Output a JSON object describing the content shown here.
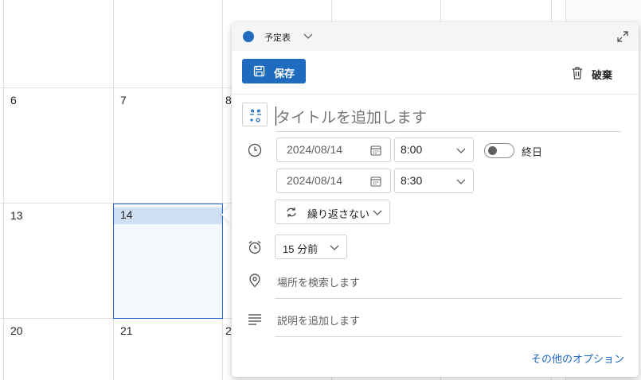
{
  "calendar": {
    "day_numbers": [
      "6",
      "7",
      "8",
      "13",
      "14",
      "20",
      "21",
      "2"
    ],
    "selected_day": "14"
  },
  "popup": {
    "calendar_name": "予定表",
    "calendar_color": "#1f6bbf",
    "save_label": "保存",
    "discard_label": "破棄",
    "title_placeholder": "タイトルを追加します",
    "start_date": "2024/08/14",
    "start_time": "8:00",
    "end_date": "2024/08/14",
    "end_time": "8:30",
    "all_day_label": "終日",
    "all_day_on": false,
    "repeat_label": "繰り返さない",
    "reminder_label": "15 分前",
    "location_placeholder": "場所を検索します",
    "description_placeholder": "説明を追加します",
    "more_options_label": "その他のオプション",
    "accent_color": "#1f6bbf"
  }
}
